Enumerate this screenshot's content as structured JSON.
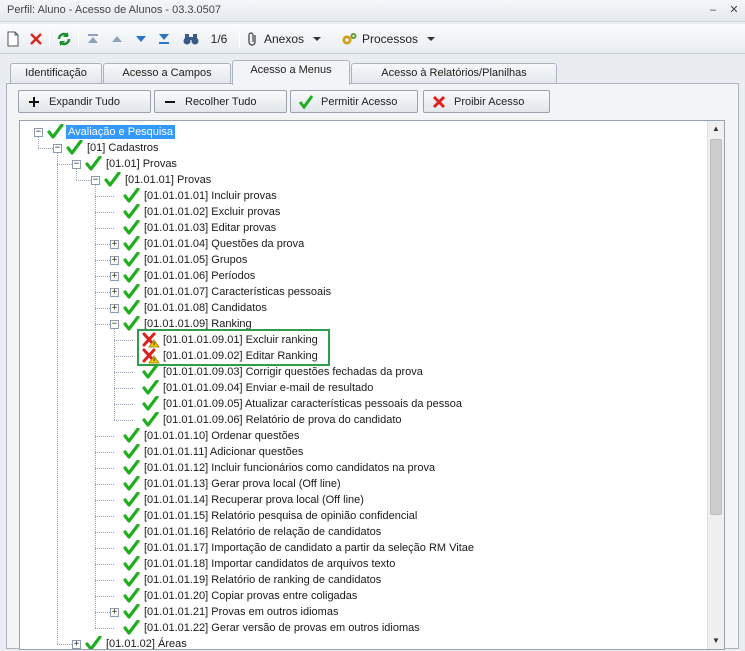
{
  "window": {
    "title": "Perfil: Aluno - Acesso de Alunos - 03.3.0507",
    "minimize_glyph": "–",
    "close_glyph": "✕"
  },
  "toolbar": {
    "record_position": "1/6",
    "attachments_label": "Anexos",
    "processes_label": "Processos"
  },
  "tabs": [
    {
      "label": "Identificação",
      "active": false
    },
    {
      "label": "Acesso a Campos",
      "active": false
    },
    {
      "label": "Acesso a Menus",
      "active": true
    },
    {
      "label": "Acesso à Relatórios/Planilhas",
      "active": false
    }
  ],
  "actions": {
    "expand_all": "Expandir Tudo",
    "collapse_all": "Recolher Tudo",
    "allow_access": "Permitir Acesso",
    "deny_access": "Proibir Acesso"
  },
  "tree": {
    "nodes": [
      {
        "level": 0,
        "label": "Avaliação e Pesquisa",
        "state": "allowed",
        "expander": "minus",
        "selected": true
      },
      {
        "level": 1,
        "label": "[01] Cadastros",
        "state": "allowed",
        "expander": "minus"
      },
      {
        "level": 2,
        "label": "[01.01] Provas",
        "state": "allowed",
        "expander": "minus"
      },
      {
        "level": 3,
        "label": "[01.01.01] Provas",
        "state": "allowed",
        "expander": "minus"
      },
      {
        "level": 4,
        "label": "[01.01.01.01] Incluir provas",
        "state": "allowed",
        "expander": "none"
      },
      {
        "level": 4,
        "label": "[01.01.01.02] Excluir provas",
        "state": "allowed",
        "expander": "none"
      },
      {
        "level": 4,
        "label": "[01.01.01.03] Editar provas",
        "state": "allowed",
        "expander": "none"
      },
      {
        "level": 4,
        "label": "[01.01.01.04] Questões da prova",
        "state": "allowed",
        "expander": "plus"
      },
      {
        "level": 4,
        "label": "[01.01.01.05] Grupos",
        "state": "allowed",
        "expander": "plus"
      },
      {
        "level": 4,
        "label": "[01.01.01.06] Períodos",
        "state": "allowed",
        "expander": "plus"
      },
      {
        "level": 4,
        "label": "[01.01.01.07] Características pessoais",
        "state": "allowed",
        "expander": "plus"
      },
      {
        "level": 4,
        "label": "[01.01.01.08] Candidatos",
        "state": "allowed",
        "expander": "plus"
      },
      {
        "level": 4,
        "label": "[01.01.01.09] Ranking",
        "state": "allowed",
        "expander": "minus"
      },
      {
        "level": 5,
        "label": "[01.01.01.09.01] Excluir ranking",
        "state": "denied",
        "expander": "none"
      },
      {
        "level": 5,
        "label": "[01.01.01.09.02] Editar Ranking",
        "state": "denied",
        "expander": "none"
      },
      {
        "level": 5,
        "label": "[01.01.01.09.03] Corrigir questões fechadas da prova",
        "state": "allowed",
        "expander": "none"
      },
      {
        "level": 5,
        "label": "[01.01.01.09.04] Enviar e-mail de resultado",
        "state": "allowed",
        "expander": "none"
      },
      {
        "level": 5,
        "label": "[01.01.01.09.05] Atualizar características pessoais da pessoa",
        "state": "allowed",
        "expander": "none"
      },
      {
        "level": 5,
        "label": "[01.01.01.09.06] Relatório de prova do candidato",
        "state": "allowed",
        "expander": "none"
      },
      {
        "level": 4,
        "label": "[01.01.01.10] Ordenar questões",
        "state": "allowed",
        "expander": "none"
      },
      {
        "level": 4,
        "label": "[01.01.01.11] Adicionar questões",
        "state": "allowed",
        "expander": "none"
      },
      {
        "level": 4,
        "label": "[01.01.01.12] Incluir funcionários como candidatos na prova",
        "state": "allowed",
        "expander": "none"
      },
      {
        "level": 4,
        "label": "[01.01.01.13] Gerar prova local (Off line)",
        "state": "allowed",
        "expander": "none"
      },
      {
        "level": 4,
        "label": "[01.01.01.14] Recuperar prova local (Off line)",
        "state": "allowed",
        "expander": "none"
      },
      {
        "level": 4,
        "label": "[01.01.01.15] Relatório pesquisa de opinião confidencial",
        "state": "allowed",
        "expander": "none"
      },
      {
        "level": 4,
        "label": "[01.01.01.16] Relatório de relação de candidatos",
        "state": "allowed",
        "expander": "none"
      },
      {
        "level": 4,
        "label": "[01.01.01.17] Importação de candidato a partir da seleção RM Vitae",
        "state": "allowed",
        "expander": "none"
      },
      {
        "level": 4,
        "label": "[01.01.01.18] Importar candidatos de arquivos texto",
        "state": "allowed",
        "expander": "none"
      },
      {
        "level": 4,
        "label": "[01.01.01.19] Relatório de ranking de candidatos",
        "state": "allowed",
        "expander": "none"
      },
      {
        "level": 4,
        "label": "[01.01.01.20] Copiar provas entre coligadas",
        "state": "allowed",
        "expander": "none"
      },
      {
        "level": 4,
        "label": "[01.01.01.21] Provas em outros idiomas",
        "state": "allowed",
        "expander": "plus"
      },
      {
        "level": 4,
        "label": "[01.01.01.22] Gerar versão de provas em outros idiomas",
        "state": "allowed",
        "expander": "none"
      },
      {
        "level": 2,
        "label": "[01.01.02] Áreas",
        "state": "allowed",
        "expander": "plus"
      }
    ]
  },
  "colors": {
    "check_green": "#1fae1f",
    "deny_red": "#e0201a",
    "warn_yellow": "#f5c400",
    "selection_blue": "#3399ff",
    "highlight_box": "#2e9e4a"
  },
  "icons": {
    "new": "new-document-icon",
    "delete": "delete-x-icon",
    "refresh": "refresh-icon",
    "first": "first-record-icon",
    "previous": "previous-record-icon",
    "next": "next-record-icon",
    "last": "last-record-icon",
    "search": "binoculars-icon",
    "attachments": "paperclip-icon",
    "processes": "gears-icon"
  }
}
